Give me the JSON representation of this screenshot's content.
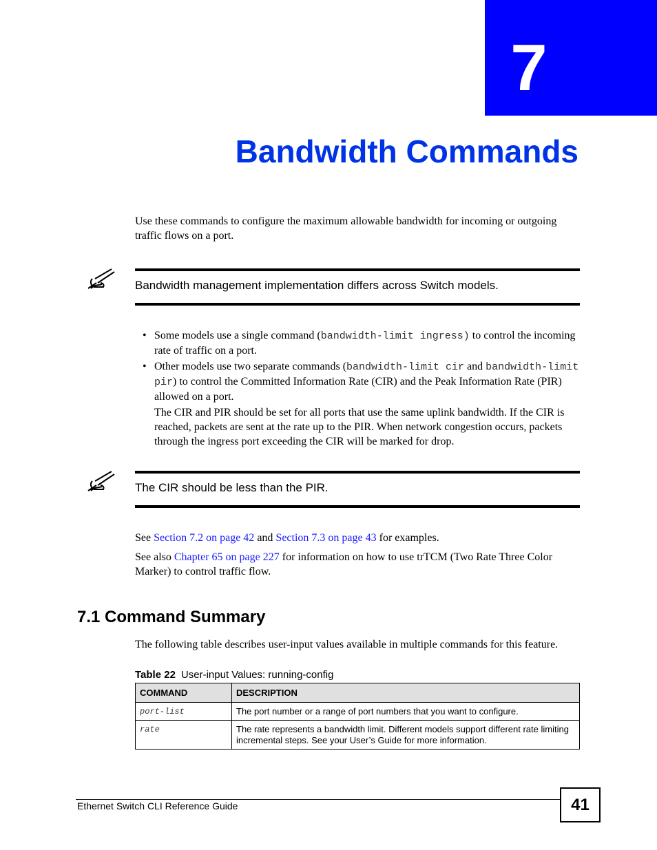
{
  "chapter": {
    "number": "7",
    "title": "Bandwidth Commands",
    "accent_color": "#0000ff",
    "title_color": "#0033e6"
  },
  "intro": "Use these commands to configure the maximum allowable bandwidth for incoming or outgoing traffic flows on a port.",
  "note1": {
    "icon": "pen-note-icon",
    "text": "Bandwidth management implementation differs across Switch models."
  },
  "bullets": [
    {
      "pre": "Some models use a single command (",
      "code": "bandwidth-limit ingress)",
      "post": " to control the incoming rate of traffic on a port."
    },
    {
      "pre": "Other models use two separate commands (",
      "code1": "bandwidth-limit cir",
      "mid": " and ",
      "code2": "bandwidth-limit pir",
      "post": ") to control the Committed Information Rate (CIR) and the Peak Information Rate (PIR) allowed on a port.",
      "sub": "The CIR and PIR should be set for all ports that use the same uplink bandwidth. If the CIR is reached, packets are sent at the rate up to the PIR. When network congestion occurs, packets through the ingress port exceeding the CIR will be marked for drop."
    }
  ],
  "note2": {
    "icon": "pen-note-icon",
    "text": "The CIR should be less than the PIR."
  },
  "see": {
    "pre": "See ",
    "link1": "Section 7.2 on page 42",
    "mid": " and ",
    "link2": "Section 7.3 on page 43",
    "post": " for examples."
  },
  "see_also": {
    "pre": "See also ",
    "link": "Chapter 65 on page 227",
    "post": " for information on how to use trTCM (Two Rate Three Color Marker) to control traffic flow."
  },
  "section": {
    "heading": "7.1  Command Summary",
    "intro": "The following table describes user-input values available in multiple commands for this feature."
  },
  "table": {
    "caption_label": "Table 22",
    "caption_text": "User-input Values: running-config",
    "headers": [
      "COMMAND",
      "DESCRIPTION"
    ],
    "rows": [
      {
        "command": "port-list",
        "description": "The port number or a range of port numbers that you want to configure."
      },
      {
        "command": "rate",
        "description": "The rate represents a bandwidth limit. Different models support different rate limiting incremental steps. See your User’s Guide for more information."
      }
    ]
  },
  "footer": {
    "guide_title": "Ethernet Switch CLI Reference Guide",
    "page_number": "41"
  }
}
